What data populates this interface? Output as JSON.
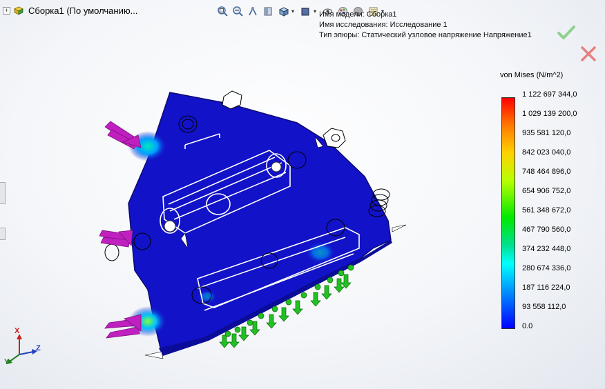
{
  "tree": {
    "expander": "+",
    "assembly_name": "Сборка1  (По умолчанию..."
  },
  "toolbar": {
    "icons": [
      "zoom-to-fit-icon",
      "zoom-to-area-icon",
      "previous-view-icon",
      "section-view-icon",
      "view-orientation-icon",
      "display-style-icon",
      "hide-show-icon",
      "appearance-icon",
      "scene-icon",
      "view-settings-icon"
    ]
  },
  "study": {
    "model_name": "Имя модели: Сборка1",
    "study_name": "Имя  исследования: Исследование 1",
    "plot_type": "Тип эпюры: Статический узловое напряжение Напряжение1"
  },
  "colors": {
    "ok": "#8fd08f",
    "cancel": "#e88080",
    "model_blue": "#1010c8",
    "fixture_green": "#22c022",
    "load_magenta": "#c020c0"
  },
  "legend": {
    "title": "von Mises (N/m^2)",
    "labels": [
      "1 122 697 344,0",
      "1 029 139 200,0",
      "935 581 120,0",
      "842 023 040,0",
      "748 464 896,0",
      "654 906 752,0",
      "561 348 672,0",
      "467 790 560,0",
      "374 232 448,0",
      "280 674 336,0",
      "187 116 224,0",
      "93 558 112,0",
      "0.0"
    ]
  },
  "triad": {
    "x": "X",
    "y": "Y",
    "z": "Z"
  }
}
